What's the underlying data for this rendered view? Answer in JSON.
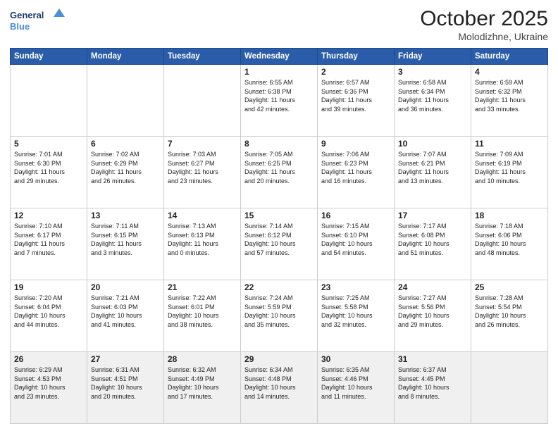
{
  "header": {
    "logo_line1": "General",
    "logo_line2": "Blue",
    "month": "October 2025",
    "location": "Molodizhne, Ukraine"
  },
  "days_of_week": [
    "Sunday",
    "Monday",
    "Tuesday",
    "Wednesday",
    "Thursday",
    "Friday",
    "Saturday"
  ],
  "weeks": [
    [
      {
        "day": "",
        "info": ""
      },
      {
        "day": "",
        "info": ""
      },
      {
        "day": "",
        "info": ""
      },
      {
        "day": "1",
        "info": "Sunrise: 6:55 AM\nSunset: 6:38 PM\nDaylight: 11 hours\nand 42 minutes."
      },
      {
        "day": "2",
        "info": "Sunrise: 6:57 AM\nSunset: 6:36 PM\nDaylight: 11 hours\nand 39 minutes."
      },
      {
        "day": "3",
        "info": "Sunrise: 6:58 AM\nSunset: 6:34 PM\nDaylight: 11 hours\nand 36 minutes."
      },
      {
        "day": "4",
        "info": "Sunrise: 6:59 AM\nSunset: 6:32 PM\nDaylight: 11 hours\nand 33 minutes."
      }
    ],
    [
      {
        "day": "5",
        "info": "Sunrise: 7:01 AM\nSunset: 6:30 PM\nDaylight: 11 hours\nand 29 minutes."
      },
      {
        "day": "6",
        "info": "Sunrise: 7:02 AM\nSunset: 6:29 PM\nDaylight: 11 hours\nand 26 minutes."
      },
      {
        "day": "7",
        "info": "Sunrise: 7:03 AM\nSunset: 6:27 PM\nDaylight: 11 hours\nand 23 minutes."
      },
      {
        "day": "8",
        "info": "Sunrise: 7:05 AM\nSunset: 6:25 PM\nDaylight: 11 hours\nand 20 minutes."
      },
      {
        "day": "9",
        "info": "Sunrise: 7:06 AM\nSunset: 6:23 PM\nDaylight: 11 hours\nand 16 minutes."
      },
      {
        "day": "10",
        "info": "Sunrise: 7:07 AM\nSunset: 6:21 PM\nDaylight: 11 hours\nand 13 minutes."
      },
      {
        "day": "11",
        "info": "Sunrise: 7:09 AM\nSunset: 6:19 PM\nDaylight: 11 hours\nand 10 minutes."
      }
    ],
    [
      {
        "day": "12",
        "info": "Sunrise: 7:10 AM\nSunset: 6:17 PM\nDaylight: 11 hours\nand 7 minutes."
      },
      {
        "day": "13",
        "info": "Sunrise: 7:11 AM\nSunset: 6:15 PM\nDaylight: 11 hours\nand 3 minutes."
      },
      {
        "day": "14",
        "info": "Sunrise: 7:13 AM\nSunset: 6:13 PM\nDaylight: 11 hours\nand 0 minutes."
      },
      {
        "day": "15",
        "info": "Sunrise: 7:14 AM\nSunset: 6:12 PM\nDaylight: 10 hours\nand 57 minutes."
      },
      {
        "day": "16",
        "info": "Sunrise: 7:15 AM\nSunset: 6:10 PM\nDaylight: 10 hours\nand 54 minutes."
      },
      {
        "day": "17",
        "info": "Sunrise: 7:17 AM\nSunset: 6:08 PM\nDaylight: 10 hours\nand 51 minutes."
      },
      {
        "day": "18",
        "info": "Sunrise: 7:18 AM\nSunset: 6:06 PM\nDaylight: 10 hours\nand 48 minutes."
      }
    ],
    [
      {
        "day": "19",
        "info": "Sunrise: 7:20 AM\nSunset: 6:04 PM\nDaylight: 10 hours\nand 44 minutes."
      },
      {
        "day": "20",
        "info": "Sunrise: 7:21 AM\nSunset: 6:03 PM\nDaylight: 10 hours\nand 41 minutes."
      },
      {
        "day": "21",
        "info": "Sunrise: 7:22 AM\nSunset: 6:01 PM\nDaylight: 10 hours\nand 38 minutes."
      },
      {
        "day": "22",
        "info": "Sunrise: 7:24 AM\nSunset: 5:59 PM\nDaylight: 10 hours\nand 35 minutes."
      },
      {
        "day": "23",
        "info": "Sunrise: 7:25 AM\nSunset: 5:58 PM\nDaylight: 10 hours\nand 32 minutes."
      },
      {
        "day": "24",
        "info": "Sunrise: 7:27 AM\nSunset: 5:56 PM\nDaylight: 10 hours\nand 29 minutes."
      },
      {
        "day": "25",
        "info": "Sunrise: 7:28 AM\nSunset: 5:54 PM\nDaylight: 10 hours\nand 26 minutes."
      }
    ],
    [
      {
        "day": "26",
        "info": "Sunrise: 6:29 AM\nSunset: 4:53 PM\nDaylight: 10 hours\nand 23 minutes."
      },
      {
        "day": "27",
        "info": "Sunrise: 6:31 AM\nSunset: 4:51 PM\nDaylight: 10 hours\nand 20 minutes."
      },
      {
        "day": "28",
        "info": "Sunrise: 6:32 AM\nSunset: 4:49 PM\nDaylight: 10 hours\nand 17 minutes."
      },
      {
        "day": "29",
        "info": "Sunrise: 6:34 AM\nSunset: 4:48 PM\nDaylight: 10 hours\nand 14 minutes."
      },
      {
        "day": "30",
        "info": "Sunrise: 6:35 AM\nSunset: 4:46 PM\nDaylight: 10 hours\nand 11 minutes."
      },
      {
        "day": "31",
        "info": "Sunrise: 6:37 AM\nSunset: 4:45 PM\nDaylight: 10 hours\nand 8 minutes."
      },
      {
        "day": "",
        "info": ""
      }
    ]
  ]
}
